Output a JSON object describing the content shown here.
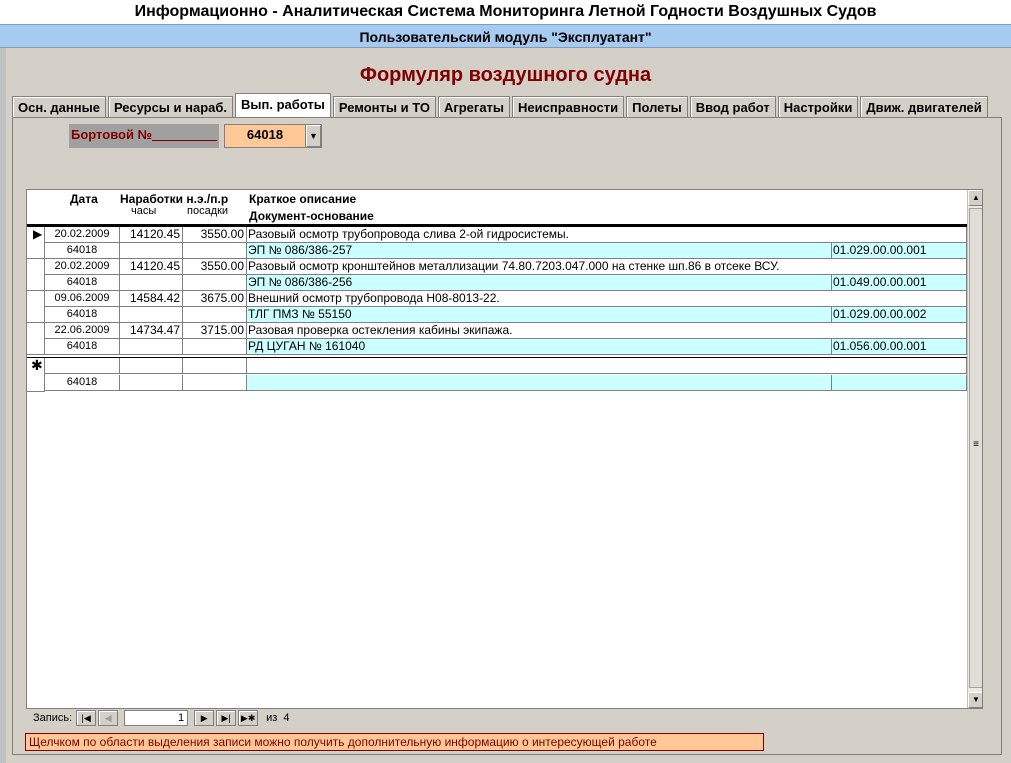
{
  "app": {
    "title": "Информационно - Аналитическая Система Мониторинга Летной Годности Воздушных Судов",
    "module": "Пользовательский модуль \"Эксплуатант\""
  },
  "form": {
    "title": "Формуляр воздушного судна"
  },
  "tabs": [
    {
      "label": "Осн. данные"
    },
    {
      "label": "Ресурсы и нараб."
    },
    {
      "label": "Вып. работы",
      "active": true
    },
    {
      "label": "Ремонты и ТО"
    },
    {
      "label": "Агрегаты"
    },
    {
      "label": "Неисправности"
    },
    {
      "label": "Полеты"
    },
    {
      "label": "Ввод работ"
    },
    {
      "label": "Настройки"
    },
    {
      "label": "Движ. двигателей"
    }
  ],
  "board": {
    "label": "Бортовой №",
    "underline": "_________",
    "value": "64018"
  },
  "grid": {
    "headers": {
      "date": "Дата",
      "narab": "Наработки н.э./п.р",
      "hours": "часы",
      "landings": "посадки",
      "desc": "Краткое описание",
      "doc": "Документ-основание"
    },
    "records": [
      {
        "date": "20.02.2009",
        "hours": "14120.45",
        "landings": "3550.00",
        "desc": "Разовый осмотр трубопровода слива 2-ой гидросистемы.",
        "board": "64018",
        "doc": "ЭП № 086/386-257",
        "code": "01.029.00.00.001"
      },
      {
        "date": "20.02.2009",
        "hours": "14120.45",
        "landings": "3550.00",
        "desc": "Разовый осмотр кронштейнов металлизации 74.80.7203.047.000 на стенке шп.86 в отсеке ВСУ.",
        "board": "64018",
        "doc": "ЭП № 086/386-256",
        "code": "01.049.00.00.001"
      },
      {
        "date": "09.06.2009",
        "hours": "14584.42",
        "landings": "3675.00",
        "desc": "Внешний осмотр трубопровода Н08-8013-22.",
        "board": "64018",
        "doc": "ТЛГ ПМЗ № 55150",
        "code": "01.029.00.00.002"
      },
      {
        "date": "22.06.2009",
        "hours": "14734.47",
        "landings": "3715.00",
        "desc": "Разовая проверка остекления кабины экипажа.",
        "board": "64018",
        "doc": "РД ЦУГАН № 161040",
        "code": "01.056.00.00.001"
      }
    ],
    "new_record": {
      "board": "64018"
    }
  },
  "navigator": {
    "label": "Запись:",
    "current": "1",
    "of_label": "из",
    "total": "4"
  },
  "status": {
    "text": "Щелчком по области выделения записи можно получить дополнительную информацию о интересующей работе"
  },
  "icons": {
    "record_selector": "current-record-arrow-icon",
    "new_record": "new-record-asterisk-icon"
  },
  "colors": {
    "title_band": "#a6caf0",
    "form_title": "#800000",
    "board_value_bg": "#ffc896",
    "doc_row_bg": "#ccffff"
  }
}
